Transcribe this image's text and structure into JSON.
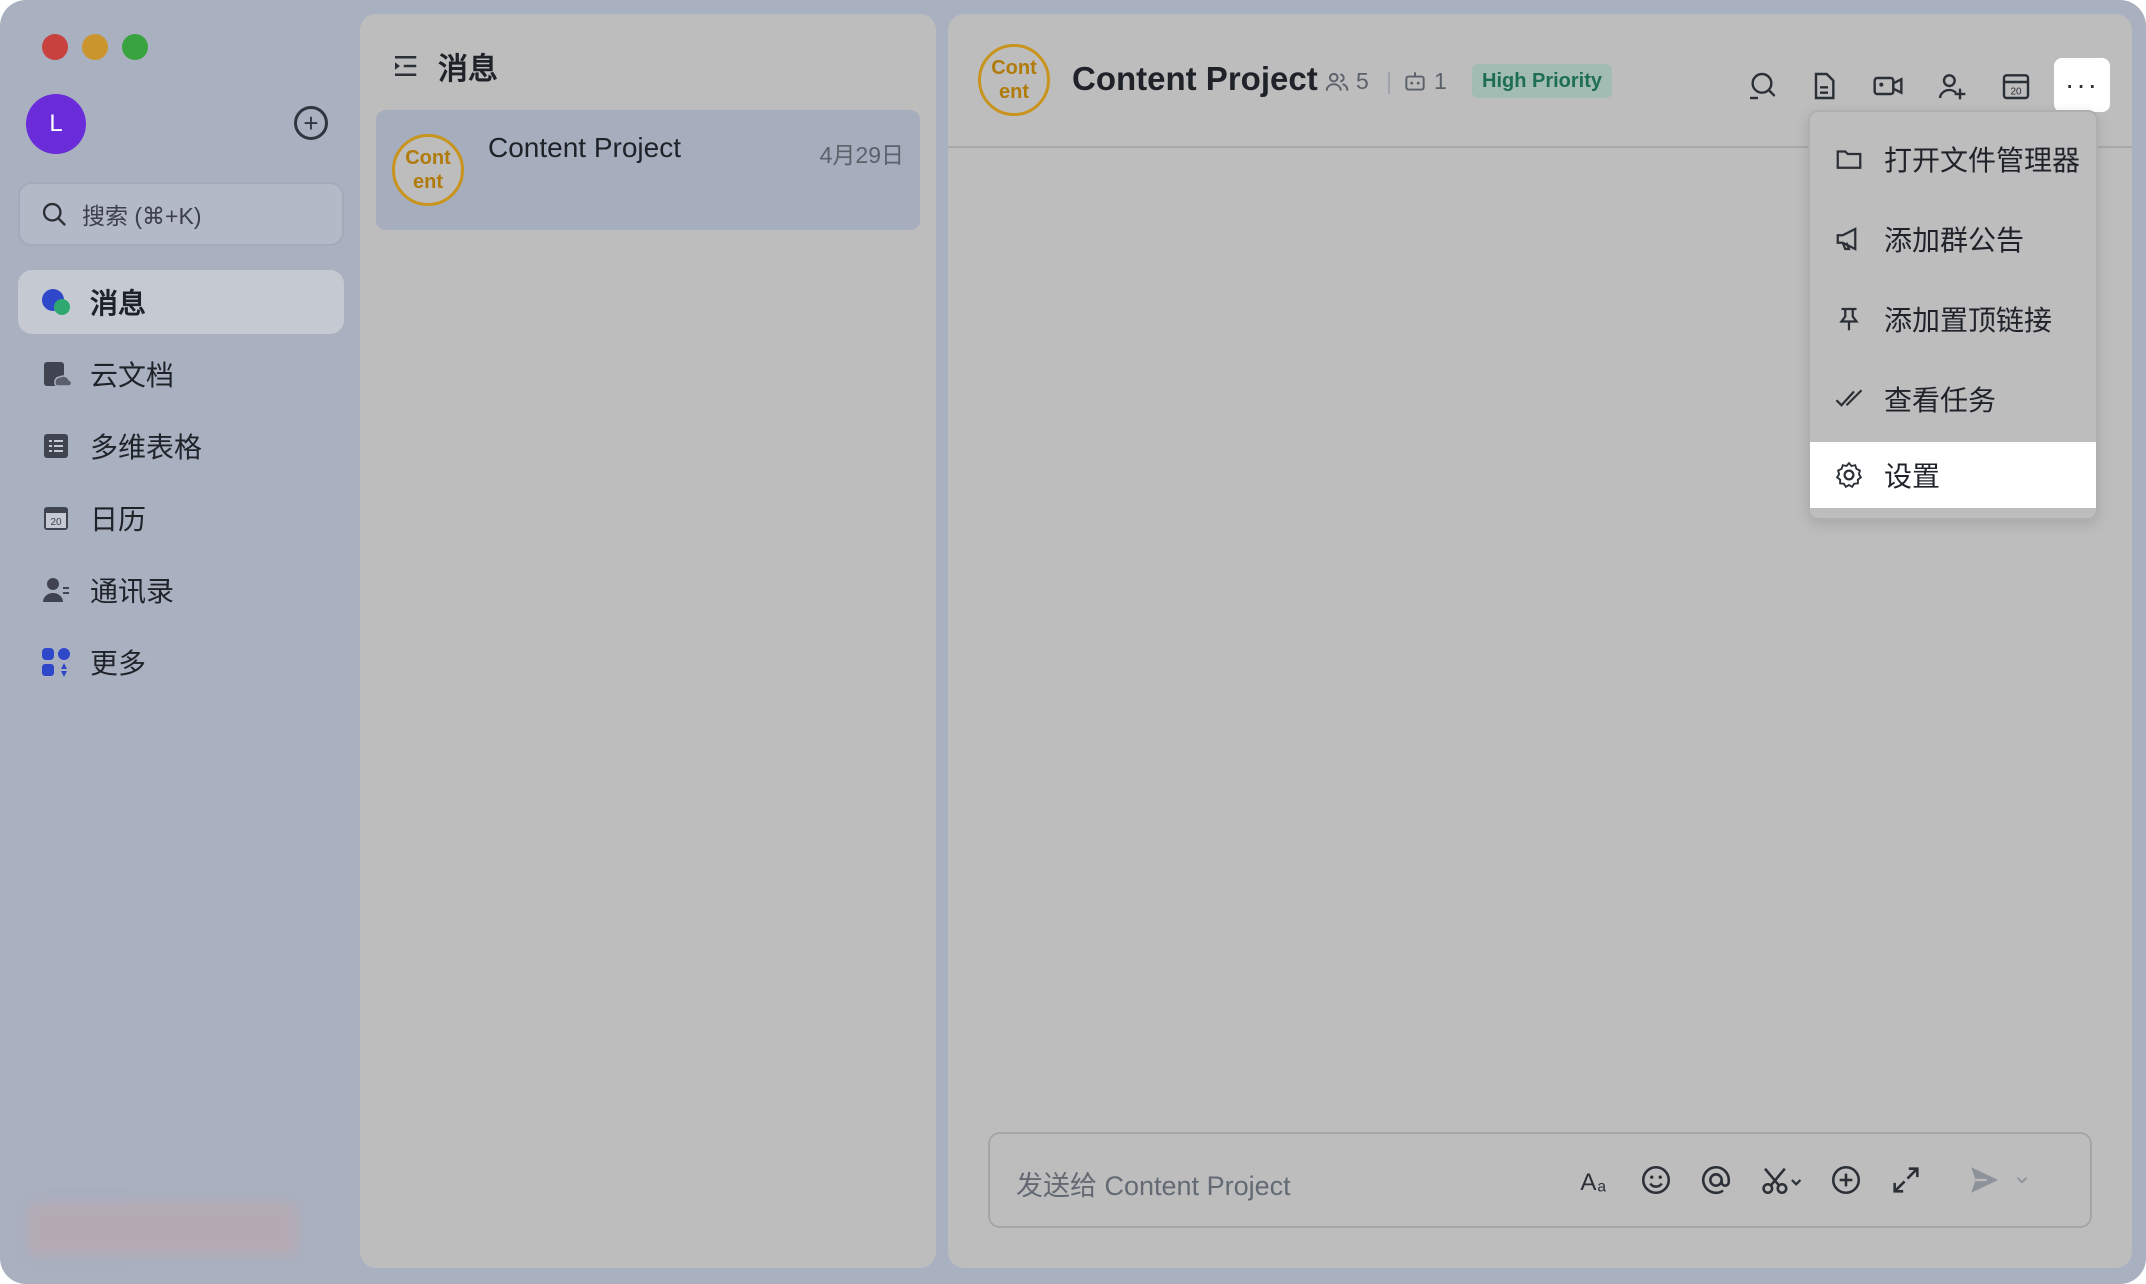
{
  "user": {
    "avatar_initial": "L"
  },
  "sidebar": {
    "search_placeholder": "搜索 (⌘+K)",
    "items": [
      {
        "label": "消息",
        "icon": "chat-bubble-icon",
        "active": true
      },
      {
        "label": "云文档",
        "icon": "cloud-doc-icon"
      },
      {
        "label": "多维表格",
        "icon": "table-icon"
      },
      {
        "label": "日历",
        "icon": "calendar-icon"
      },
      {
        "label": "通讯录",
        "icon": "contacts-icon"
      },
      {
        "label": "更多",
        "icon": "apps-grid-icon"
      }
    ]
  },
  "chat_list": {
    "title": "消息",
    "items": [
      {
        "avatar_line1": "Cont",
        "avatar_line2": "ent",
        "name": "Content Project",
        "date": "4月29日"
      }
    ]
  },
  "conversation": {
    "avatar_line1": "Cont",
    "avatar_line2": "ent",
    "title": "Content Project",
    "member_count": "5",
    "bot_count": "1",
    "priority_badge": "High Priority",
    "header_icons": [
      "search-icon",
      "document-icon",
      "video-call-icon",
      "add-member-icon",
      "calendar-icon",
      "more-icon"
    ],
    "more_label": "···",
    "input_placeholder": "发送给 Content Project",
    "input_tools": [
      "text-format-icon",
      "emoji-icon",
      "mention-icon",
      "screenshot-icon",
      "plus-icon",
      "expand-icon",
      "send-icon"
    ]
  },
  "dropdown_menu": {
    "items": [
      {
        "label": "打开文件管理器",
        "icon": "folder-icon"
      },
      {
        "label": "添加群公告",
        "icon": "megaphone-icon"
      },
      {
        "label": "添加置顶链接",
        "icon": "pin-icon"
      },
      {
        "label": "查看任务",
        "icon": "task-check-icon"
      },
      {
        "label": "设置",
        "icon": "gear-icon",
        "highlighted": true
      }
    ]
  },
  "colors": {
    "window_bg": "#a9b0c0",
    "panel_bg": "#bdbdbd",
    "selected_chat": "#a6adbd",
    "user_avatar": "#6a2bd9",
    "group_avatar_ring": "#c8941e",
    "priority_badge_bg": "#a2bcb3",
    "priority_badge_text": "#1e6e56"
  }
}
